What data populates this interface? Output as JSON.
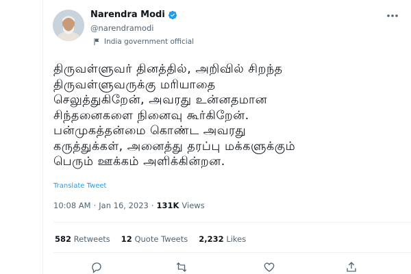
{
  "author": {
    "name": "Narendra Modi",
    "handle": "@narendramodi",
    "label": "India government official",
    "verified_icon": "verified-badge-icon",
    "colors": {
      "verified": "#1d9bf0"
    }
  },
  "tweet": {
    "lines": [
      "திருவள்ளுவர் தினத்தில், அறிவில் சிறந்த",
      "திருவள்ளுவருக்கு மரியாதை",
      "செலுத்துகிறேன், அவரது உன்னதமான",
      "சிந்தனைகளை நினைவு கூர்கிறேன்.",
      "பன்முகத்தன்மை கொண்ட அவரது",
      "கருத்துக்கள், அனைத்து தரப்பு மக்களுக்கும்",
      "பெரும் ஊக்கம் அளிக்கின்றன."
    ],
    "translate_label": "Translate Tweet",
    "time": "10:08 AM",
    "separator": "·",
    "date": "Jan 16, 2023",
    "views_count": "131K",
    "views_label": "Views"
  },
  "stats": {
    "retweets_count": "582",
    "retweets_label": "Retweets",
    "quotes_count": "12",
    "quotes_label": "Quote Tweets",
    "likes_count": "2,232",
    "likes_label": "Likes"
  },
  "colors": {
    "link": "#1d9bf0",
    "secondary": "#536471",
    "primary": "#0f1419",
    "border": "#eff3f4"
  }
}
